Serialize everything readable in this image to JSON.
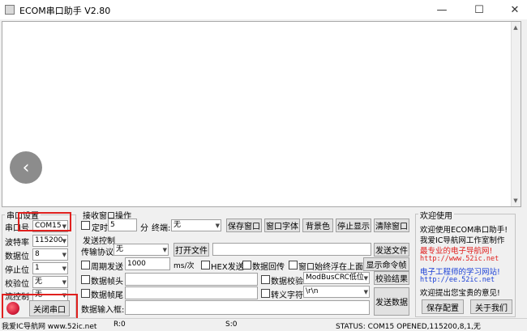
{
  "window": {
    "title": "ECOM串口助手   V2.80",
    "minimize": "—",
    "maximize": "☐",
    "close": "✕"
  },
  "nav_arrow": "‹",
  "serial_settings": {
    "group_label": "串口设置",
    "port_label": "串口号",
    "port_value": "COM15",
    "baud_label": "波特率",
    "baud_value": "115200",
    "data_bits_label": "数据位",
    "data_bits_value": "8",
    "stop_bits_label": "停止位",
    "stop_bits_value": "1",
    "parity_label": "校验位",
    "parity_value": "无",
    "flow_label": "流控制",
    "flow_value": "无",
    "close_port_button": "关闭串口"
  },
  "receive": {
    "group_label": "接收窗口操作",
    "timer_label": "定时",
    "timer_value": "5",
    "timer_unit": "分",
    "terminal_label": "终端:",
    "terminal_value": "无",
    "buttons": [
      "保存窗口",
      "窗口字体",
      "背景色",
      "停止显示",
      "清除窗口"
    ]
  },
  "send": {
    "group_label": "发送控制",
    "protocol_label": "传输协议",
    "protocol_value": "无",
    "open_file_button": "打开文件",
    "send_file_button": "发送文件",
    "periodic_label": "周期发送",
    "periodic_value": "1000",
    "periodic_unit": "ms/次",
    "hex_send_label": "HEX发送",
    "data_echo_label": "数据回传",
    "on_top_label": "窗口始终浮在上面",
    "show_cmd_button": "显示命令帧",
    "frame_head_label": "数据帧头",
    "checksum_label": "数据校验",
    "checksum_value": "ModBusCRC低位",
    "checksum_result_button": "校验结果",
    "frame_tail_label": "数据帧尾",
    "escape_label": "转义字符",
    "escape_value": "\\r\\n",
    "input_label": "数据输入框:",
    "send_data_button": "发送数据"
  },
  "welcome": {
    "group_label": "欢迎使用",
    "lines": [
      {
        "text": "欢迎使用ECOM串口助手!",
        "color": "#000000"
      },
      {
        "text": "我爱IC导航网工作室制作",
        "color": "#000000"
      },
      {
        "text": "最专业的电子导航网!",
        "color": "#e0201e"
      },
      {
        "text": "http://www.52ic.net",
        "color": "#e0201e"
      },
      {
        "text": "电子工程师的学习网站!",
        "color": "#1a3fd6"
      },
      {
        "text": "http://ee.52ic.net",
        "color": "#1a3fd6"
      },
      {
        "text": "欢迎提出您宝贵的意见!",
        "color": "#000000"
      }
    ],
    "save_config_button": "保存配置",
    "about_button": "关于我们"
  },
  "status": {
    "site": "我爱IC导航网 www.52ic.net",
    "rx": "R:0",
    "tx": "S:0",
    "status_text": "STATUS:  COM15 OPENED,115200,8,1,无"
  },
  "colors": {
    "highlight": "#e0201e",
    "led": "#d41e3a"
  }
}
